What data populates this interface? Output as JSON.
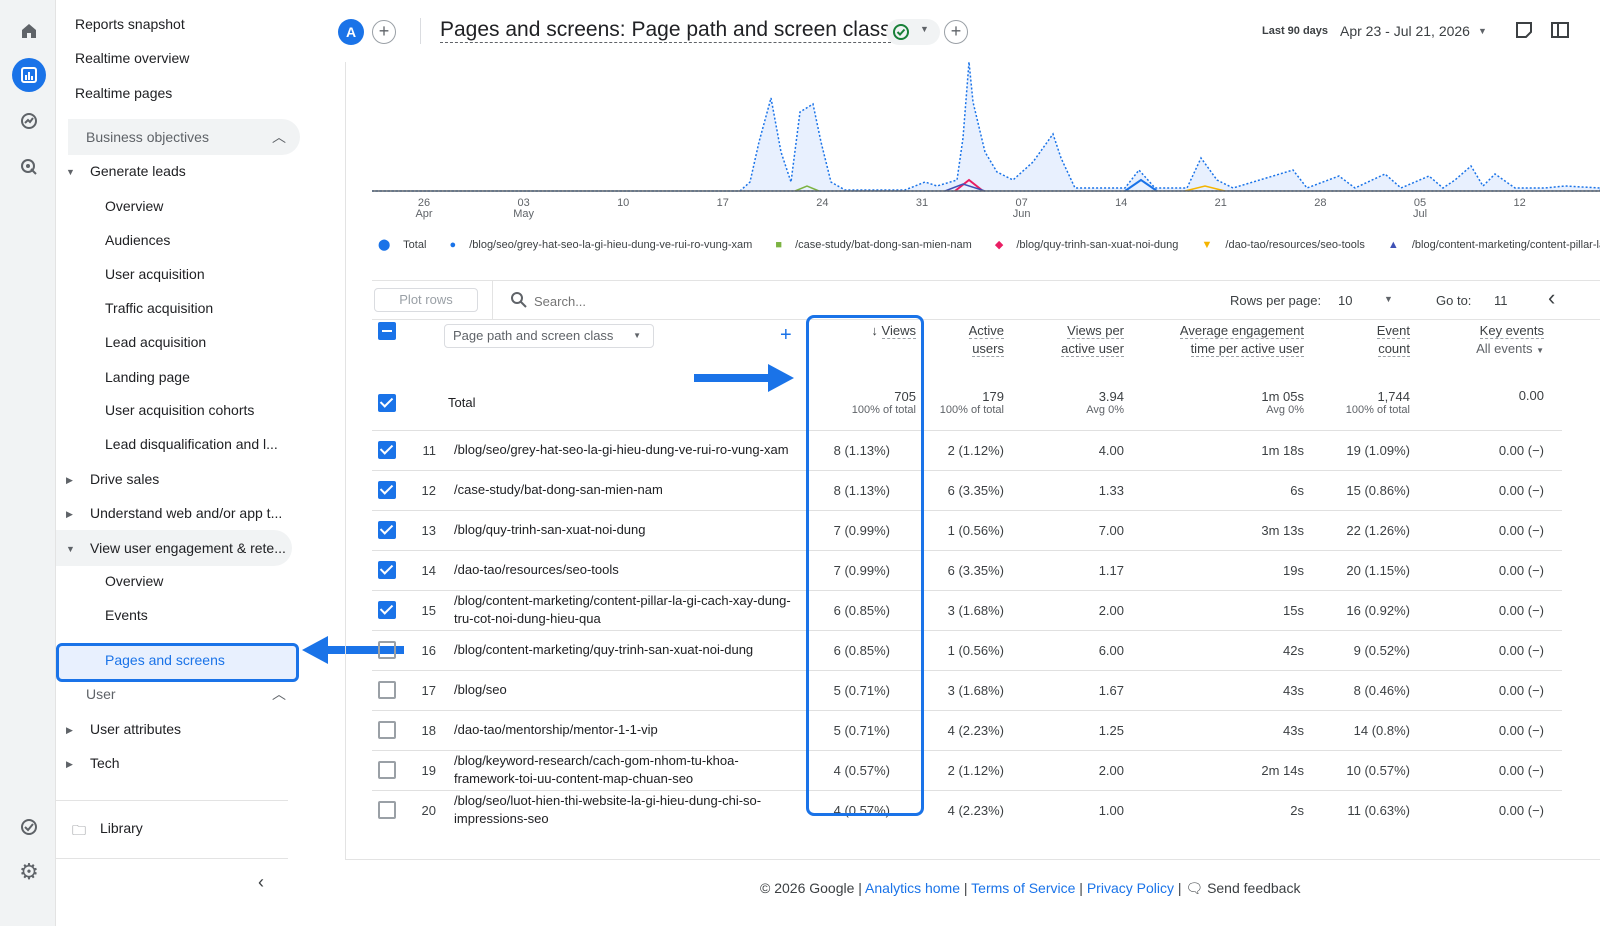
{
  "nav": {
    "reports_snapshot": "Reports snapshot",
    "realtime_overview": "Realtime overview",
    "realtime_pages": "Realtime pages",
    "business_objectives": "Business objectives",
    "generate_leads": "Generate leads",
    "gl_items": [
      "Overview",
      "Audiences",
      "User acquisition",
      "Traffic acquisition",
      "Lead acquisition",
      "Landing page",
      "User acquisition cohorts",
      "Lead disqualification and l..."
    ],
    "drive_sales": "Drive sales",
    "understand": "Understand web and/or app t...",
    "view_engagement": "View user engagement & rete...",
    "ve_items": [
      "Overview",
      "Events",
      "Pages and screens"
    ],
    "user_section": "User",
    "user_attributes": "User attributes",
    "tech": "Tech",
    "library": "Library"
  },
  "header": {
    "avatar": "A",
    "title": "Pages and screens: Page path and screen class",
    "date_prefix": "Last 90 days",
    "date_range": "Apr 23 - Jul 21, 2026"
  },
  "chart_axis": {
    "ticks": [
      [
        "26",
        "Apr"
      ],
      [
        "03",
        "May"
      ],
      [
        "10",
        ""
      ],
      [
        "17",
        ""
      ],
      [
        "24",
        ""
      ],
      [
        "31",
        ""
      ],
      [
        "07",
        "Jun"
      ],
      [
        "14",
        ""
      ],
      [
        "21",
        ""
      ],
      [
        "28",
        ""
      ],
      [
        "05",
        "Jul"
      ],
      [
        "12",
        ""
      ]
    ]
  },
  "legend": [
    "Total",
    "/blog/seo/grey-hat-seo-la-gi-hieu-dung-ve-rui-ro-vung-xam",
    "/case-study/bat-dong-san-mien-nam",
    "/blog/quy-trinh-san-xuat-noi-dung",
    "/dao-tao/resources/seo-tools",
    "/blog/content-marketing/content-pillar-la-gi-ca"
  ],
  "legend_colors": [
    "#1a73e8",
    "#1a73e8",
    "#7cb342",
    "#e91e63",
    "#f4b400",
    "#3f51b5"
  ],
  "toolbar": {
    "plot_rows": "Plot rows",
    "search_placeholder": "Search...",
    "rows_per_page_label": "Rows per page:",
    "rows_per_page": "10",
    "goto_label": "Go to:",
    "goto": "11"
  },
  "table": {
    "dimension": "Page path and screen class",
    "headers": {
      "views": "Views",
      "active1": "Active",
      "active2": "users",
      "vpau1": "Views per",
      "vpau2": "active user",
      "aet1": "Average engagement",
      "aet2": "time per active user",
      "ec1": "Event",
      "ec2": "count",
      "ke1": "Key events",
      "ke2": "All events"
    },
    "total": {
      "label": "Total",
      "views": "705",
      "views_sub": "100% of total",
      "users": "179",
      "users_sub": "100% of total",
      "vpau": "3.94",
      "vpau_sub": "Avg 0%",
      "aet": "1m 05s",
      "aet_sub": "Avg 0%",
      "ec": "1,744",
      "ec_sub": "100% of total",
      "ke": "0.00"
    },
    "rows": [
      {
        "n": "11",
        "checked": true,
        "path": "/blog/seo/grey-hat-seo-la-gi-hieu-dung-ve-rui-ro-vung-xam",
        "views": "8 (1.13%)",
        "users": "2 (1.12%)",
        "vpau": "4.00",
        "aet": "1m 18s",
        "ec": "19 (1.09%)",
        "ke": "0.00 (−)"
      },
      {
        "n": "12",
        "checked": true,
        "path": "/case-study/bat-dong-san-mien-nam",
        "views": "8 (1.13%)",
        "users": "6 (3.35%)",
        "vpau": "1.33",
        "aet": "6s",
        "ec": "15 (0.86%)",
        "ke": "0.00 (−)"
      },
      {
        "n": "13",
        "checked": true,
        "path": "/blog/quy-trinh-san-xuat-noi-dung",
        "views": "7 (0.99%)",
        "users": "1 (0.56%)",
        "vpau": "7.00",
        "aet": "3m 13s",
        "ec": "22 (1.26%)",
        "ke": "0.00 (−)"
      },
      {
        "n": "14",
        "checked": true,
        "path": "/dao-tao/resources/seo-tools",
        "views": "7 (0.99%)",
        "users": "6 (3.35%)",
        "vpau": "1.17",
        "aet": "19s",
        "ec": "20 (1.15%)",
        "ke": "0.00 (−)"
      },
      {
        "n": "15",
        "checked": true,
        "path": "/blog/content-marketing/content-pillar-la-gi-cach-xay-dung-tru-cot-noi-dung-hieu-qua",
        "views": "6 (0.85%)",
        "users": "3 (1.68%)",
        "vpau": "2.00",
        "aet": "15s",
        "ec": "16 (0.92%)",
        "ke": "0.00 (−)"
      },
      {
        "n": "16",
        "checked": false,
        "path": "/blog/content-marketing/quy-trinh-san-xuat-noi-dung",
        "views": "6 (0.85%)",
        "users": "1 (0.56%)",
        "vpau": "6.00",
        "aet": "42s",
        "ec": "9 (0.52%)",
        "ke": "0.00 (−)"
      },
      {
        "n": "17",
        "checked": false,
        "path": "/blog/seo",
        "views": "5 (0.71%)",
        "users": "3 (1.68%)",
        "vpau": "1.67",
        "aet": "43s",
        "ec": "8 (0.46%)",
        "ke": "0.00 (−)"
      },
      {
        "n": "18",
        "checked": false,
        "path": "/dao-tao/mentorship/mentor-1-1-vip",
        "views": "5 (0.71%)",
        "users": "4 (2.23%)",
        "vpau": "1.25",
        "aet": "43s",
        "ec": "14 (0.8%)",
        "ke": "0.00 (−)"
      },
      {
        "n": "19",
        "checked": false,
        "path": "/blog/keyword-research/cach-gom-nhom-tu-khoa-framework-toi-uu-content-map-chuan-seo",
        "views": "4 (0.57%)",
        "users": "2 (1.12%)",
        "vpau": "2.00",
        "aet": "2m 14s",
        "ec": "10 (0.57%)",
        "ke": "0.00 (−)"
      },
      {
        "n": "20",
        "checked": false,
        "path": "/blog/seo/luot-hien-thi-website-la-gi-hieu-dung-chi-so-impressions-seo",
        "views": "4 (0.57%)",
        "users": "4 (2.23%)",
        "vpau": "1.00",
        "aet": "2s",
        "ec": "11 (0.63%)",
        "ke": "0.00 (−)"
      }
    ]
  },
  "footer": {
    "copyright": "© 2026 Google |",
    "analytics_home": "Analytics home",
    "terms": "Terms of Service",
    "privacy": "Privacy Policy",
    "send_feedback": "Send feedback"
  }
}
